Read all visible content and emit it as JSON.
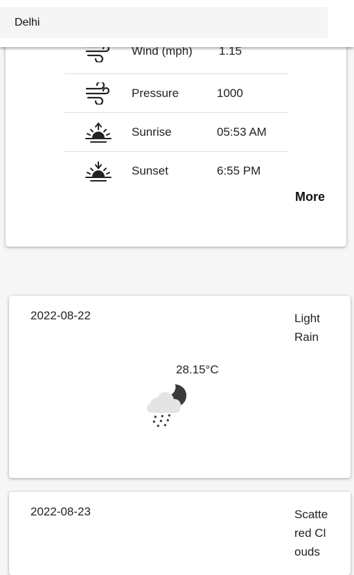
{
  "search": {
    "value": "Delhi",
    "placeholder": ""
  },
  "details": [
    {
      "icon": "wind-icon",
      "label": "Wind (mph)",
      "value": "1.15"
    },
    {
      "icon": "pressure-icon",
      "label": "Pressure",
      "value": "1000"
    },
    {
      "icon": "sunrise-icon",
      "label": "Sunrise",
      "value": "05:53 AM"
    },
    {
      "icon": "sunset-icon",
      "label": "Sunset",
      "value": "6:55 PM"
    }
  ],
  "more_label": "More",
  "forecast": [
    {
      "date": "2022-08-22",
      "description": "Light Rain",
      "temp": "28.15°C",
      "icon": "light-rain-night-icon"
    },
    {
      "date": "2022-08-23",
      "description": "Scattered Clouds",
      "temp": "",
      "icon": ""
    }
  ],
  "colors": {
    "background": "#f6f6f6",
    "card": "#ffffff",
    "search_bg": "#f5f5f5",
    "icon": "#222222"
  }
}
